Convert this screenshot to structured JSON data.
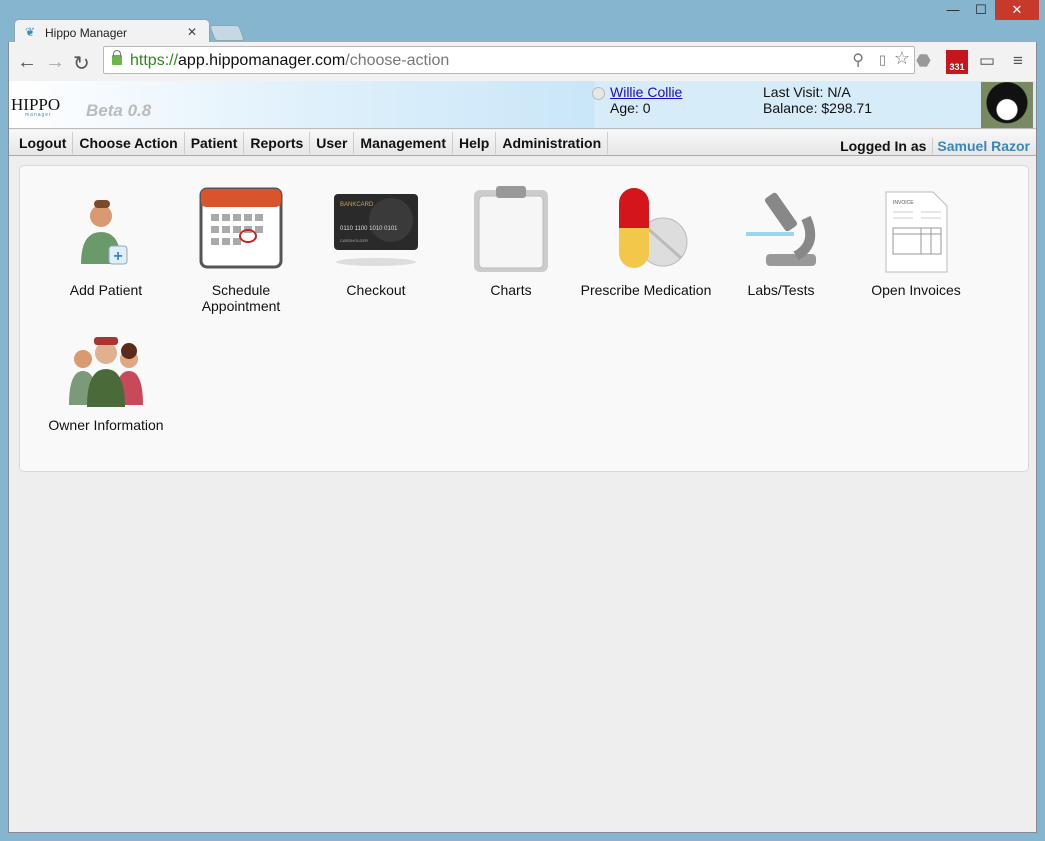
{
  "browser": {
    "tab_title": "Hippo Manager",
    "url_scheme": "https://",
    "url_host": "app.hippomanager.com",
    "url_path": "/choose-action",
    "gmail_badge": "331"
  },
  "header": {
    "logo": "HIPPO",
    "logo_sub": "manager",
    "version": "Beta 0.8",
    "patient_name": "Willie Collie",
    "age": "Age: 0",
    "last_visit": "Last Visit: N/A",
    "balance": "Balance: $298.71"
  },
  "menu": [
    "Logout",
    "Choose Action",
    "Patient",
    "Reports",
    "User",
    "Management",
    "Help",
    "Administration"
  ],
  "logged_in_label": "Logged In as",
  "user_name": "Samuel Razor",
  "actions": [
    {
      "label": "Add Patient",
      "icon": "add-patient-icon"
    },
    {
      "label": "Schedule Appointment",
      "icon": "calendar-icon"
    },
    {
      "label": "Checkout",
      "icon": "credit-card-icon"
    },
    {
      "label": "Charts",
      "icon": "clipboard-icon"
    },
    {
      "label": "Prescribe Medication",
      "icon": "pill-icon"
    },
    {
      "label": "Labs/Tests",
      "icon": "microscope-icon"
    },
    {
      "label": "Open Invoices",
      "icon": "invoice-icon"
    },
    {
      "label": "Owner Information",
      "icon": "people-icon"
    }
  ],
  "card_text": {
    "brand": "BANKCARD",
    "number": "0110 1100 1010 0101",
    "holder": "CARDHOLDER"
  },
  "invoice_text": "INVOICE"
}
